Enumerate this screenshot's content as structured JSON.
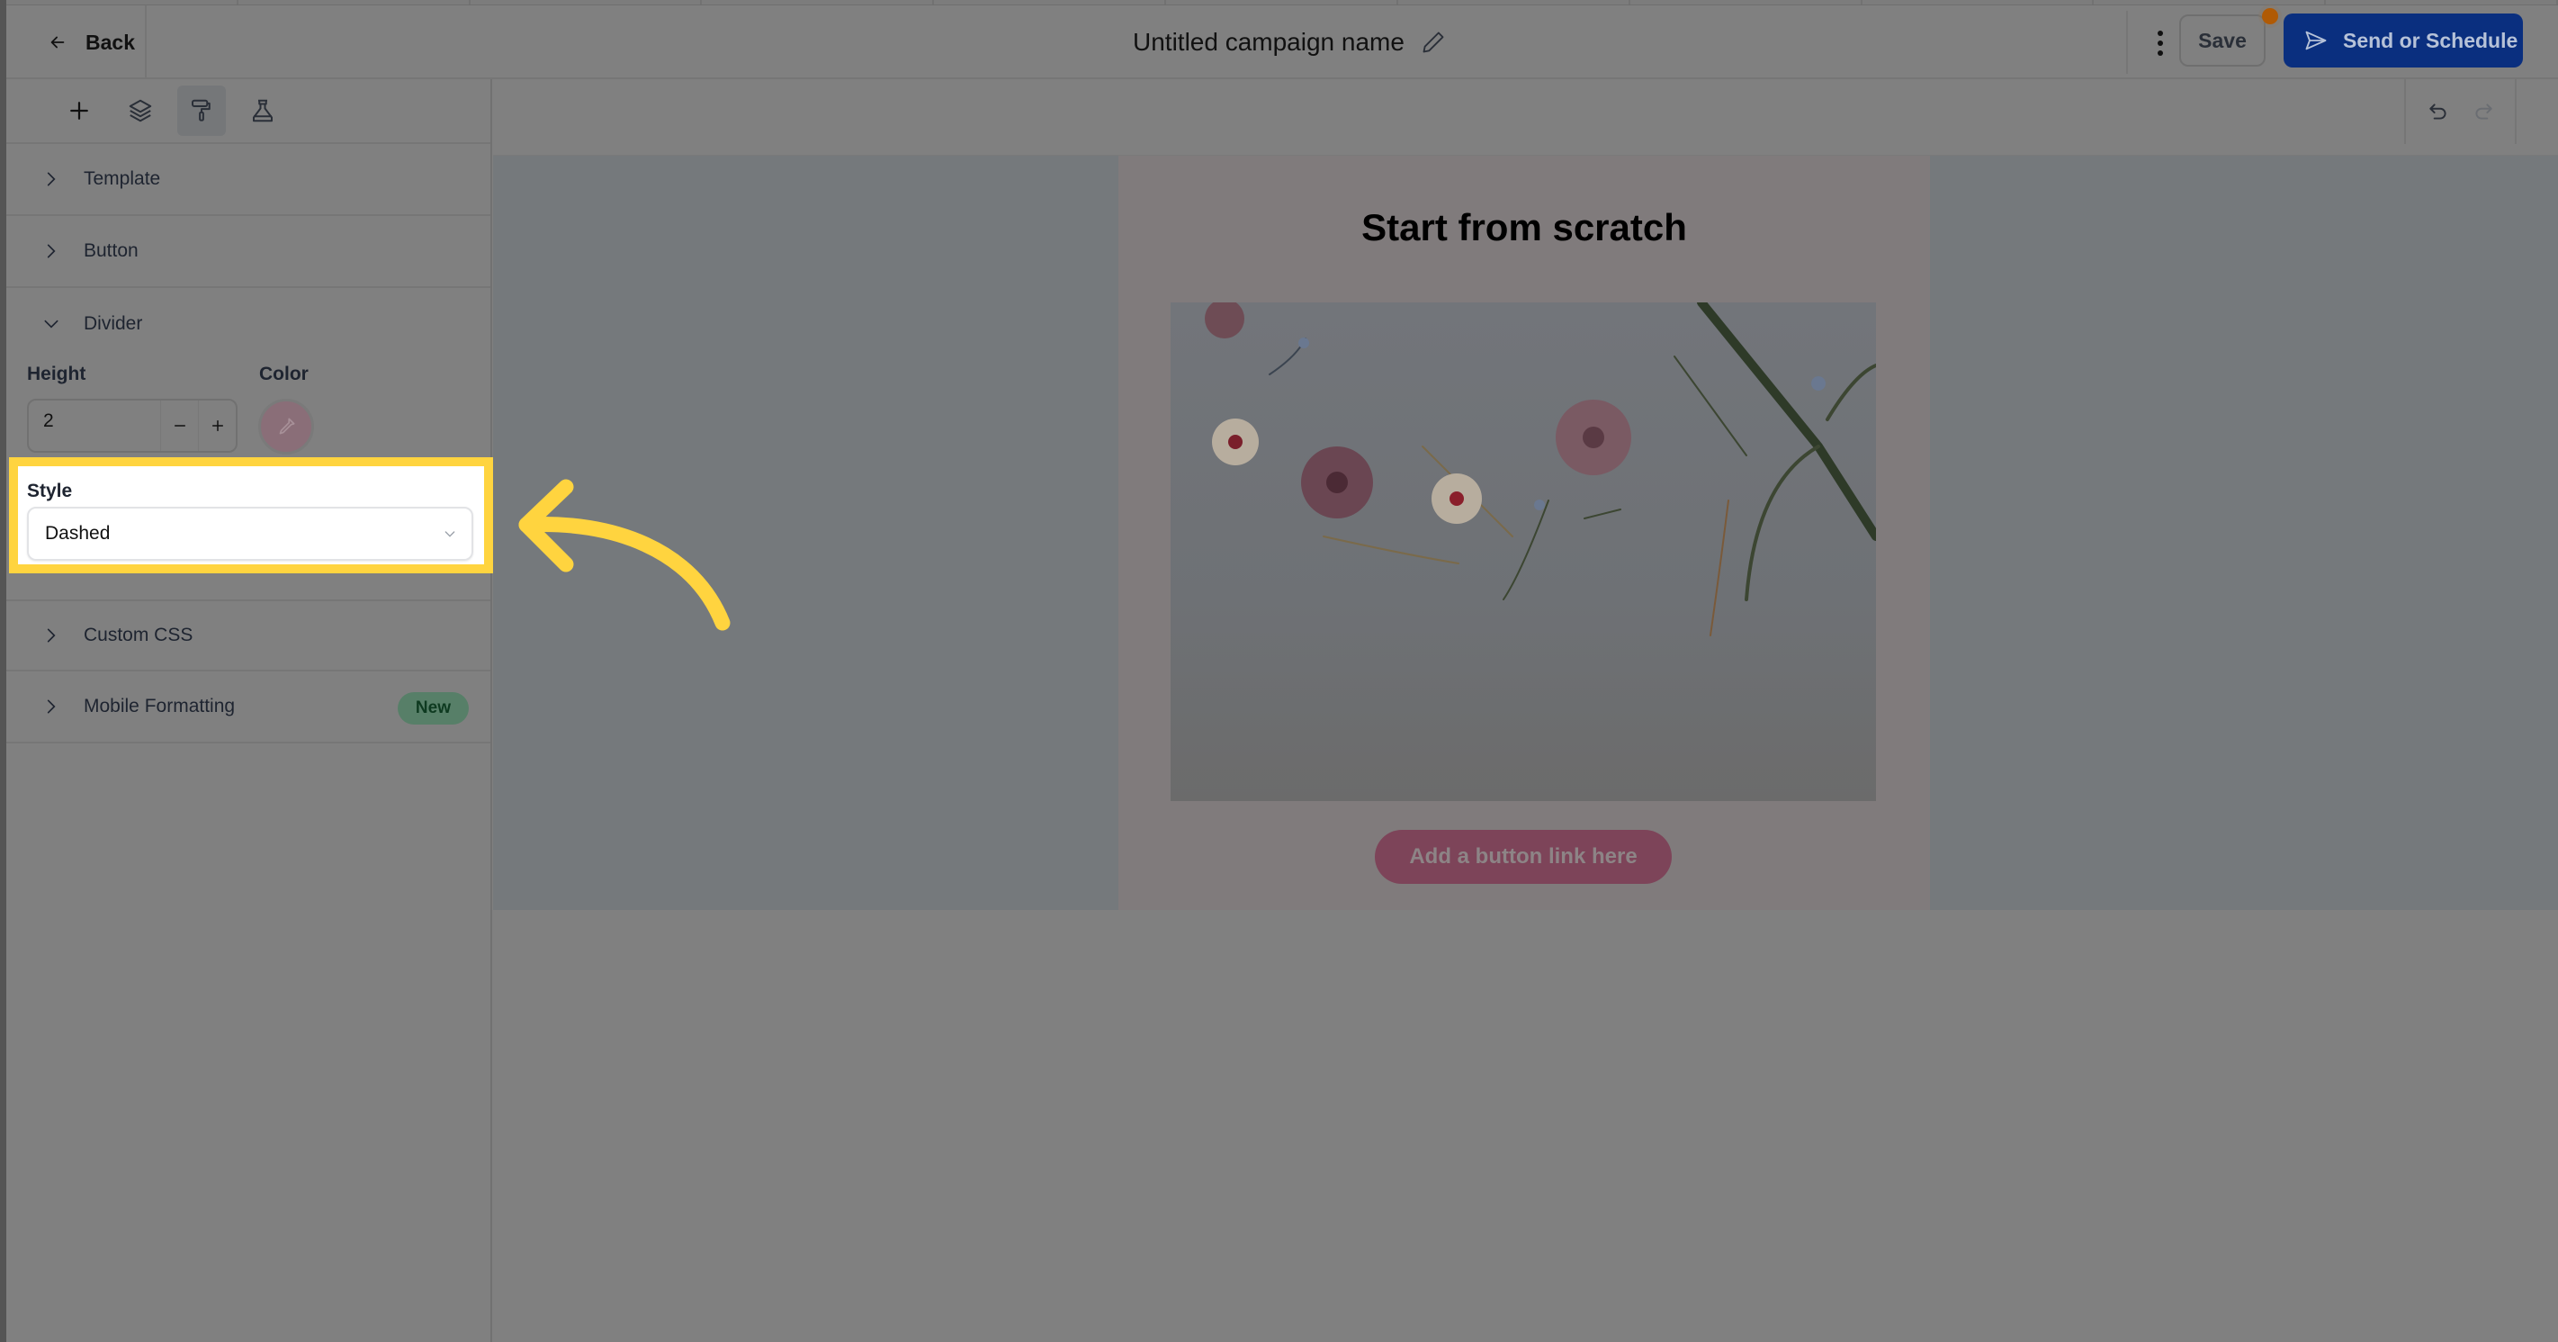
{
  "header": {
    "back_label": "Back",
    "campaign_title": "Untitled campaign name",
    "save_label": "Save",
    "send_label": "Send or Schedule",
    "send_color": "#0a2f7f",
    "notification_dot_color": "#b05a05"
  },
  "toolbar": {
    "tools": [
      {
        "icon": "plus-icon",
        "label": "Add"
      },
      {
        "icon": "layers-icon",
        "label": "Layers"
      },
      {
        "icon": "paint-roller-icon",
        "label": "Style",
        "active": true
      },
      {
        "icon": "flask-icon",
        "label": "Test"
      }
    ]
  },
  "sidebar": {
    "sections": [
      {
        "label": "Template",
        "expanded": false
      },
      {
        "label": "Button",
        "expanded": false
      },
      {
        "label": "Divider",
        "expanded": true
      },
      {
        "label": "Custom CSS",
        "expanded": false
      },
      {
        "label": "Mobile Formatting",
        "expanded": false,
        "badge": "New"
      }
    ],
    "divider": {
      "height_label": "Height",
      "height_value": "2",
      "color_label": "Color",
      "style_label": "Style",
      "style_value": "Dashed"
    }
  },
  "canvas": {
    "email_title": "Start from scratch",
    "image_alt": "Pressed flowers on a light background",
    "button_label": "Add a button link here",
    "button_color": "#d9638f"
  },
  "annotation": {
    "highlight_color": "#ffd43f",
    "target": "Style dropdown"
  }
}
